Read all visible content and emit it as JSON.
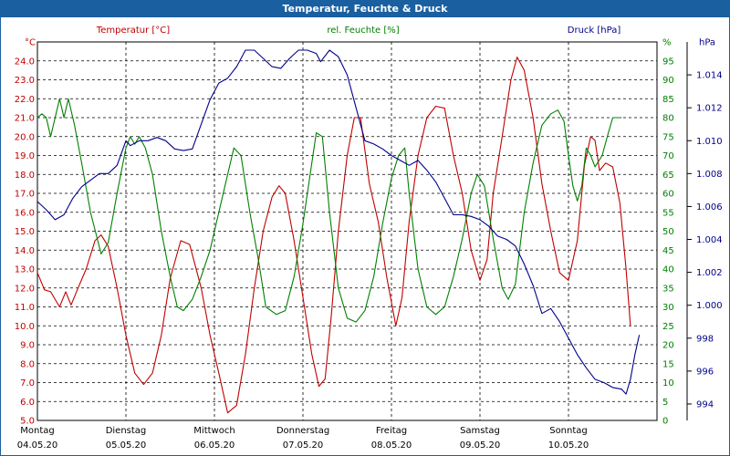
{
  "chart_data": {
    "type": "line",
    "title": "Temperatur, Feuchte & Druck",
    "axes": {
      "temperature": {
        "label": "Temperatur [°C]",
        "unit": "°C",
        "min": 5.0,
        "max": 25.0,
        "ticks": [
          "5.0",
          "6.0",
          "7.0",
          "8.0",
          "9.0",
          "10.0",
          "11.0",
          "12.0",
          "13.0",
          "14.0",
          "15.0",
          "16.0",
          "17.0",
          "18.0",
          "19.0",
          "20.0",
          "21.0",
          "22.0",
          "23.0",
          "24.0"
        ],
        "color": "#c00000"
      },
      "humidity": {
        "label": "rel. Feuchte [%]",
        "unit": "%",
        "min": 0,
        "max": 100,
        "ticks": [
          "0",
          "5",
          "10",
          "15",
          "20",
          "25",
          "30",
          "35",
          "40",
          "45",
          "50",
          "55",
          "60",
          "65",
          "70",
          "75",
          "80",
          "85",
          "90",
          "95"
        ],
        "color": "#008000"
      },
      "pressure": {
        "label": "Druck [hPa]",
        "unit": "hPa",
        "min": 993,
        "max": 1016,
        "ticks": [
          "994",
          "996",
          "998",
          "1.000",
          "1.002",
          "1.004",
          "1.006",
          "1.008",
          "1.010",
          "1.012",
          "1.014"
        ],
        "tick_values": [
          994,
          996,
          998,
          1000,
          1002,
          1004,
          1006,
          1008,
          1010,
          1012,
          1014
        ],
        "color": "#00008b"
      }
    },
    "x": {
      "min": 0,
      "max": 7,
      "labels": [
        {
          "day": "Montag",
          "date": "04.05.20"
        },
        {
          "day": "Dienstag",
          "date": "05.05.20"
        },
        {
          "day": "Mittwoch",
          "date": "06.05.20"
        },
        {
          "day": "Donnerstag",
          "date": "07.05.20"
        },
        {
          "day": "Freitag",
          "date": "08.05.20"
        },
        {
          "day": "Samstag",
          "date": "09.05.20"
        },
        {
          "day": "Sonntag",
          "date": "10.05.20"
        }
      ]
    },
    "grid": true,
    "series": [
      {
        "name": "Temperatur [°C]",
        "axis": "temperature",
        "color": "#c00000",
        "points": [
          [
            0,
            12.8
          ],
          [
            0.08,
            11.9
          ],
          [
            0.15,
            11.8
          ],
          [
            0.25,
            11.0
          ],
          [
            0.32,
            11.8
          ],
          [
            0.38,
            11.1
          ],
          [
            0.45,
            11.9
          ],
          [
            0.55,
            13.0
          ],
          [
            0.65,
            14.5
          ],
          [
            0.72,
            14.8
          ],
          [
            0.8,
            14.2
          ],
          [
            0.9,
            12.0
          ],
          [
            1.0,
            9.5
          ],
          [
            1.1,
            7.5
          ],
          [
            1.2,
            6.9
          ],
          [
            1.3,
            7.5
          ],
          [
            1.4,
            9.5
          ],
          [
            1.5,
            12.5
          ],
          [
            1.62,
            14.5
          ],
          [
            1.72,
            14.3
          ],
          [
            1.85,
            12.0
          ],
          [
            1.95,
            9.5
          ],
          [
            2.05,
            7.5
          ],
          [
            2.15,
            5.4
          ],
          [
            2.25,
            5.8
          ],
          [
            2.35,
            8.5
          ],
          [
            2.45,
            12.0
          ],
          [
            2.55,
            15.0
          ],
          [
            2.65,
            16.8
          ],
          [
            2.73,
            17.4
          ],
          [
            2.8,
            17.0
          ],
          [
            2.9,
            14.5
          ],
          [
            3.0,
            11.5
          ],
          [
            3.1,
            8.5
          ],
          [
            3.18,
            6.8
          ],
          [
            3.25,
            7.2
          ],
          [
            3.32,
            10.5
          ],
          [
            3.4,
            15.0
          ],
          [
            3.5,
            19.0
          ],
          [
            3.58,
            21.0
          ],
          [
            3.65,
            21.0
          ],
          [
            3.75,
            17.5
          ],
          [
            3.85,
            15.5
          ],
          [
            3.95,
            12.5
          ],
          [
            4.05,
            10.0
          ],
          [
            4.12,
            11.5
          ],
          [
            4.2,
            15.5
          ],
          [
            4.3,
            19.0
          ],
          [
            4.4,
            21.0
          ],
          [
            4.5,
            21.6
          ],
          [
            4.6,
            21.5
          ],
          [
            4.7,
            19.0
          ],
          [
            4.8,
            17.0
          ],
          [
            4.9,
            14.0
          ],
          [
            5.0,
            12.4
          ],
          [
            5.08,
            13.5
          ],
          [
            5.15,
            17.0
          ],
          [
            5.25,
            20.0
          ],
          [
            5.35,
            23.0
          ],
          [
            5.42,
            24.2
          ],
          [
            5.5,
            23.5
          ],
          [
            5.6,
            21.0
          ],
          [
            5.7,
            17.5
          ],
          [
            5.8,
            15.0
          ],
          [
            5.9,
            12.8
          ],
          [
            6.0,
            12.4
          ],
          [
            6.1,
            14.5
          ],
          [
            6.18,
            18.5
          ],
          [
            6.25,
            20.0
          ],
          [
            6.3,
            19.8
          ],
          [
            6.35,
            18.2
          ],
          [
            6.42,
            18.6
          ],
          [
            6.5,
            18.4
          ],
          [
            6.58,
            16.5
          ],
          [
            6.65,
            13.0
          ],
          [
            6.7,
            10.0
          ]
        ]
      },
      {
        "name": "rel. Feuchte [%]",
        "axis": "humidity",
        "color": "#008000",
        "points": [
          [
            0,
            80
          ],
          [
            0.05,
            81
          ],
          [
            0.1,
            80
          ],
          [
            0.15,
            75
          ],
          [
            0.25,
            85
          ],
          [
            0.3,
            80
          ],
          [
            0.35,
            85
          ],
          [
            0.42,
            78
          ],
          [
            0.5,
            68
          ],
          [
            0.6,
            55
          ],
          [
            0.72,
            44
          ],
          [
            0.8,
            47
          ],
          [
            0.9,
            60
          ],
          [
            1.0,
            72
          ],
          [
            1.05,
            75
          ],
          [
            1.1,
            73
          ],
          [
            1.15,
            75
          ],
          [
            1.22,
            72
          ],
          [
            1.3,
            65
          ],
          [
            1.4,
            50
          ],
          [
            1.5,
            38
          ],
          [
            1.58,
            30
          ],
          [
            1.65,
            29
          ],
          [
            1.75,
            32
          ],
          [
            1.85,
            38
          ],
          [
            1.95,
            45
          ],
          [
            2.05,
            55
          ],
          [
            2.15,
            65
          ],
          [
            2.22,
            72
          ],
          [
            2.3,
            70
          ],
          [
            2.4,
            55
          ],
          [
            2.5,
            42
          ],
          [
            2.58,
            30
          ],
          [
            2.7,
            28
          ],
          [
            2.8,
            29
          ],
          [
            2.9,
            38
          ],
          [
            3.0,
            52
          ],
          [
            3.1,
            68
          ],
          [
            3.15,
            76
          ],
          [
            3.22,
            75
          ],
          [
            3.3,
            55
          ],
          [
            3.4,
            35
          ],
          [
            3.5,
            27
          ],
          [
            3.6,
            26
          ],
          [
            3.7,
            29
          ],
          [
            3.8,
            38
          ],
          [
            3.9,
            52
          ],
          [
            4.0,
            64
          ],
          [
            4.08,
            70
          ],
          [
            4.15,
            72
          ],
          [
            4.2,
            60
          ],
          [
            4.3,
            40
          ],
          [
            4.4,
            30
          ],
          [
            4.5,
            28
          ],
          [
            4.6,
            30
          ],
          [
            4.7,
            38
          ],
          [
            4.8,
            48
          ],
          [
            4.9,
            60
          ],
          [
            4.97,
            65
          ],
          [
            5.05,
            62
          ],
          [
            5.15,
            48
          ],
          [
            5.25,
            35
          ],
          [
            5.32,
            32
          ],
          [
            5.4,
            36
          ],
          [
            5.5,
            55
          ],
          [
            5.6,
            68
          ],
          [
            5.7,
            78
          ],
          [
            5.8,
            81
          ],
          [
            5.88,
            82
          ],
          [
            5.95,
            79
          ],
          [
            6.0,
            70
          ],
          [
            6.05,
            62
          ],
          [
            6.1,
            58
          ],
          [
            6.15,
            62
          ],
          [
            6.2,
            72
          ],
          [
            6.25,
            70
          ],
          [
            6.3,
            67
          ],
          [
            6.38,
            70
          ],
          [
            6.45,
            76
          ],
          [
            6.5,
            80
          ],
          [
            6.6,
            80
          ]
        ]
      },
      {
        "name": "Druck [hPa]",
        "axis": "pressure",
        "color": "#00008b",
        "points": [
          [
            0,
            1006.3
          ],
          [
            0.1,
            1005.8
          ],
          [
            0.2,
            1005.2
          ],
          [
            0.3,
            1005.5
          ],
          [
            0.4,
            1006.5
          ],
          [
            0.5,
            1007.2
          ],
          [
            0.6,
            1007.6
          ],
          [
            0.7,
            1008.0
          ],
          [
            0.8,
            1008.0
          ],
          [
            0.9,
            1008.5
          ],
          [
            1.0,
            1010.0
          ],
          [
            1.05,
            1009.7
          ],
          [
            1.15,
            1010.0
          ],
          [
            1.25,
            1010.0
          ],
          [
            1.35,
            1010.2
          ],
          [
            1.45,
            1010.0
          ],
          [
            1.55,
            1009.5
          ],
          [
            1.65,
            1009.4
          ],
          [
            1.75,
            1009.5
          ],
          [
            1.85,
            1011.0
          ],
          [
            1.95,
            1012.5
          ],
          [
            2.05,
            1013.5
          ],
          [
            2.15,
            1013.8
          ],
          [
            2.25,
            1014.5
          ],
          [
            2.35,
            1015.5
          ],
          [
            2.45,
            1015.5
          ],
          [
            2.55,
            1015.0
          ],
          [
            2.65,
            1014.5
          ],
          [
            2.75,
            1014.4
          ],
          [
            2.85,
            1015.0
          ],
          [
            2.95,
            1015.5
          ],
          [
            3.05,
            1015.5
          ],
          [
            3.15,
            1015.3
          ],
          [
            3.2,
            1014.8
          ],
          [
            3.3,
            1015.5
          ],
          [
            3.4,
            1015.1
          ],
          [
            3.5,
            1014.0
          ],
          [
            3.6,
            1012.0
          ],
          [
            3.7,
            1010.0
          ],
          [
            3.8,
            1009.8
          ],
          [
            3.9,
            1009.5
          ],
          [
            4.0,
            1009.1
          ],
          [
            4.1,
            1008.8
          ],
          [
            4.2,
            1008.5
          ],
          [
            4.3,
            1008.8
          ],
          [
            4.4,
            1008.2
          ],
          [
            4.5,
            1007.5
          ],
          [
            4.6,
            1006.5
          ],
          [
            4.7,
            1005.5
          ],
          [
            4.8,
            1005.5
          ],
          [
            4.9,
            1005.4
          ],
          [
            5.0,
            1005.2
          ],
          [
            5.1,
            1004.8
          ],
          [
            5.2,
            1004.2
          ],
          [
            5.3,
            1004.0
          ],
          [
            5.4,
            1003.6
          ],
          [
            5.5,
            1002.5
          ],
          [
            5.6,
            1001.2
          ],
          [
            5.7,
            999.5
          ],
          [
            5.8,
            999.8
          ],
          [
            5.9,
            999.0
          ],
          [
            6.0,
            998.0
          ],
          [
            6.1,
            997.0
          ],
          [
            6.2,
            996.2
          ],
          [
            6.3,
            995.5
          ],
          [
            6.4,
            995.3
          ],
          [
            6.5,
            995.0
          ],
          [
            6.6,
            994.9
          ],
          [
            6.65,
            994.6
          ],
          [
            6.7,
            995.5
          ],
          [
            6.75,
            997.0
          ],
          [
            6.8,
            998.2
          ]
        ]
      }
    ]
  }
}
